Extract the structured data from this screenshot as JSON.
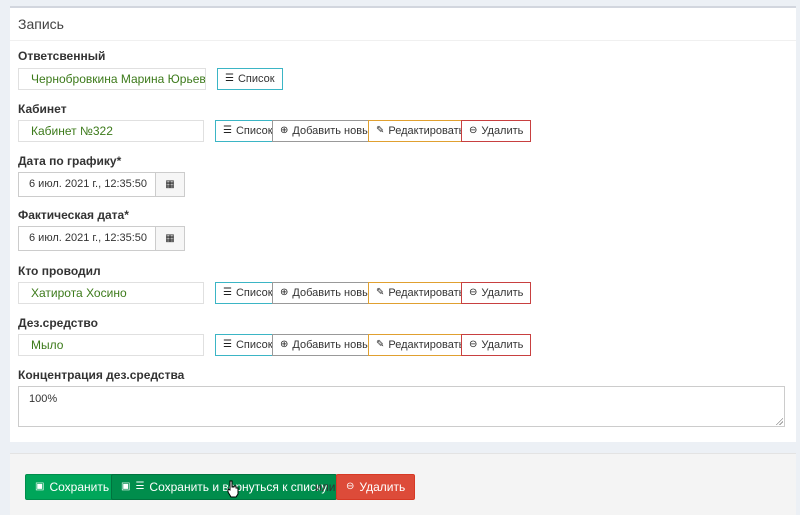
{
  "panel": {
    "title": "Запись"
  },
  "responsible": {
    "label": "Ответсвенный",
    "value": "Чернобровкина Марина Юрьевна",
    "list_button": "Список"
  },
  "cabinet": {
    "label": "Кабинет",
    "value": "Кабинет №322",
    "list_button": "Список",
    "add_button": "Добавить новый",
    "edit_button": "Редактировать",
    "delete_button": "Удалить"
  },
  "scheduled_date": {
    "label": "Дата по графику*",
    "value": "6 июл. 2021 г., 12:35:50"
  },
  "actual_date": {
    "label": "Фактическая дата*",
    "value": "6 июл. 2021 г., 12:35:50"
  },
  "performer": {
    "label": "Кто проводил",
    "value": "Хатирота Хосино",
    "list_button": "Список",
    "add_button": "Добавить новый",
    "edit_button": "Редактировать",
    "delete_button": "Удалить"
  },
  "disinfectant": {
    "label": "Дез.средство",
    "value": "Мыло",
    "list_button": "Список",
    "add_button": "Добавить новый",
    "edit_button": "Редактировать",
    "delete_button": "Удалить"
  },
  "concentration": {
    "label": "Концентрация дез.средства",
    "value": "100%"
  },
  "footer": {
    "save": "Сохранить",
    "save_and_return": "Сохранить и вернуться к списку",
    "or_text": "или",
    "delete": "Удалить"
  },
  "colors": {
    "primary_green": "#00a65a",
    "dark_green": "#008d4c",
    "danger_red": "#dd4b39",
    "value_green": "#3c7a1a"
  }
}
